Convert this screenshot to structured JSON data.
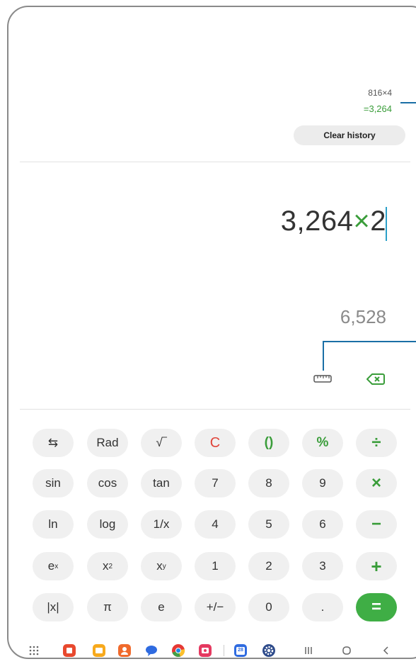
{
  "history": {
    "expression": "816×4",
    "result": "=3,264",
    "clear_label": "Clear history"
  },
  "display": {
    "expr_num1": "3,264",
    "expr_op": "×",
    "expr_num2": "2",
    "preview": "6,528"
  },
  "keys": {
    "swap": "⇆",
    "rad": "Rad",
    "sqrt": "√‾",
    "clear": "C",
    "parens": "()",
    "percent": "%",
    "divide": "÷",
    "sin": "sin",
    "cos": "cos",
    "tan": "tan",
    "seven": "7",
    "eight": "8",
    "nine": "9",
    "multiply": "×",
    "ln": "ln",
    "log": "log",
    "reciprocal": "1/x",
    "four": "4",
    "five": "5",
    "six": "6",
    "minus": "−",
    "ex_base": "e",
    "ex_sup": "x",
    "x2_base": "x",
    "x2_sup": "2",
    "xy_base": "x",
    "xy_sup": "y",
    "one": "1",
    "two": "2",
    "three": "3",
    "plus": "+",
    "abs": "|x|",
    "pi": "π",
    "e": "e",
    "negate": "+/−",
    "zero": "0",
    "decimal": ".",
    "equals": "="
  },
  "navbar": {
    "calendar_day": "28"
  },
  "colors": {
    "accent": "#3a9d3a",
    "clear_red": "#e0443a",
    "equals_bg": "#3fae45",
    "callout": "#1a6fa6"
  }
}
